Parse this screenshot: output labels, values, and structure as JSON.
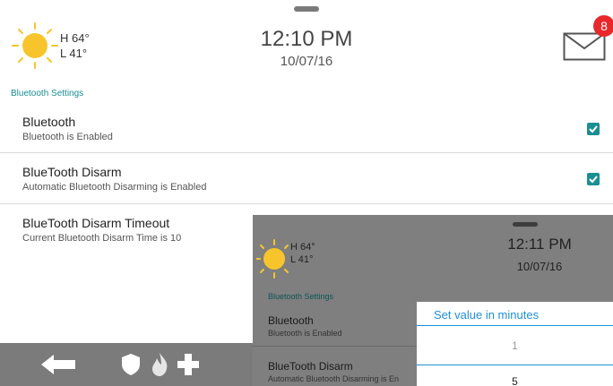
{
  "header": {
    "weather": {
      "high": "H 64°",
      "low": "L 41°",
      "icon": "sun-icon"
    },
    "time": "12:10 PM",
    "date": "10/07/16",
    "messages": {
      "icon": "mail-icon",
      "badge_count": "8",
      "badge_color": "#e8282b"
    }
  },
  "section_title": "Bluetooth Settings",
  "settings": [
    {
      "title": "Bluetooth",
      "subtitle": "Bluetooth is Enabled",
      "checked": true
    },
    {
      "title": "BlueTooth Disarm",
      "subtitle": "Automatic Bluetooth Disarming is Enabled",
      "checked": true
    },
    {
      "title": "BlueTooth Disarm Timeout",
      "subtitle": "Current Bluetooth Disarm Time is 10"
    }
  ],
  "bottom_bar": {
    "icons": [
      "back-arrow-icon",
      "shield-icon",
      "fire-icon",
      "medical-cross-icon"
    ],
    "color": "#7b7b7b"
  },
  "overlay": {
    "header": {
      "high": "H 64°",
      "low": "L 41°",
      "time": "12:11 PM",
      "date": "10/07/16"
    },
    "section_title": "Bluetooth Settings",
    "settings": [
      {
        "title": "Bluetooth",
        "subtitle": "Bluetooth is Enabled"
      },
      {
        "title": "BlueTooth Disarm",
        "subtitle": "Automatic Bluetooth Disarming is En"
      }
    ],
    "dialog": {
      "title": "Set value in minutes",
      "values": [
        "1",
        "5"
      ]
    }
  },
  "colors": {
    "accent": "#1a8f93",
    "dialog_accent": "#1f8fd6",
    "sun": "#f7c52b"
  }
}
